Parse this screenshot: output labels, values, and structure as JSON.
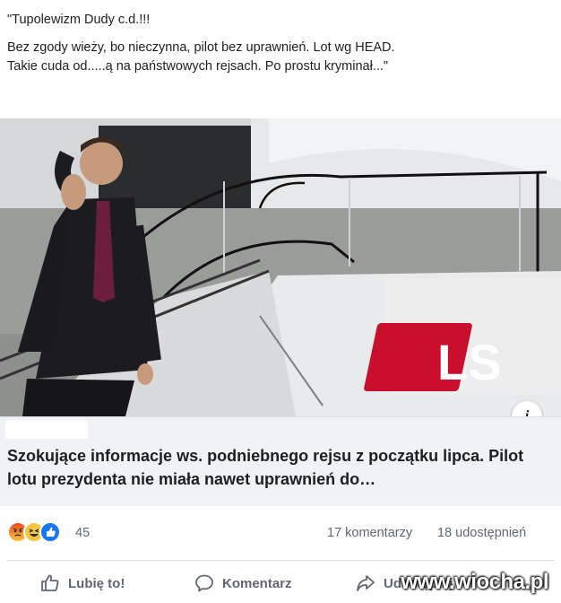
{
  "post": {
    "text_line_1": "\"Tupolewizm Dudy c.d.!!!",
    "text_line_2": "Bez zgody wieży, bo nieczynna, pilot bez uprawnień. Lot wg HEAD.",
    "text_line_3": "Takie cuda od.....ą na państwowych rejsach. Po prostu kryminał...\""
  },
  "link": {
    "image_logo_text": "LS",
    "title": "Szokujące informacje ws. podniebnego rejsu z początku lipca. Pilot lotu prezydenta nie miała nawet uprawnień do…",
    "info_icon": "i"
  },
  "reactions": {
    "icons": [
      "angry-icon",
      "haha-icon",
      "like-icon"
    ],
    "count": "45",
    "comments": "17 komentarzy",
    "shares": "18 udostępnień"
  },
  "actions": {
    "like_label": "Lubię to!",
    "comment_label": "Komentarz",
    "share_label": "Udostępnij"
  },
  "watermark": "www.wiocha.pl",
  "colors": {
    "like_blue": "#1877f2",
    "secondary_text": "#606770",
    "logo_red": "#c8102e"
  }
}
